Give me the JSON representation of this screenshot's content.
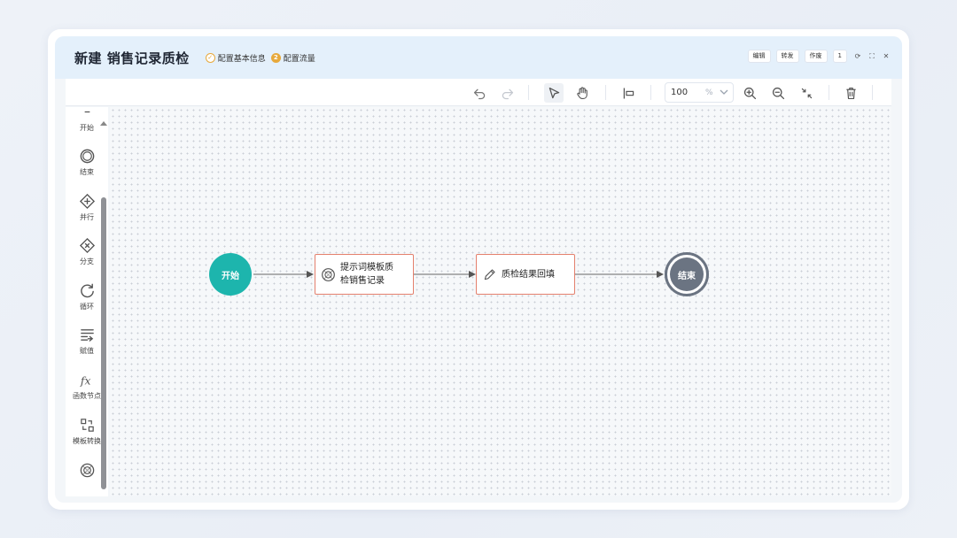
{
  "header": {
    "title": "新建 销售记录质检",
    "steps": [
      {
        "label": "配置基本信息",
        "state": "done"
      },
      {
        "label": "配置流量",
        "state": "current"
      }
    ],
    "actions": [
      {
        "label": "编辑"
      },
      {
        "label": "转发"
      },
      {
        "label": "作废"
      },
      {
        "label": "1"
      }
    ],
    "accent_color": "#e7a93c"
  },
  "toolbar": {
    "zoom_value": "100",
    "zoom_unit": "%",
    "tools": [
      "undo-icon",
      "redo-icon",
      "select-pointer-icon",
      "hand-pan-icon",
      "align-icon",
      "zoom-in-icon",
      "zoom-out-icon",
      "fit-view-icon",
      "delete-icon"
    ]
  },
  "sidebar": {
    "items": [
      {
        "label": "开始",
        "icon": "start-icon"
      },
      {
        "label": "结束",
        "icon": "end-circle-icon"
      },
      {
        "label": "并行",
        "icon": "parallel-gateway-icon"
      },
      {
        "label": "分支",
        "icon": "branch-gateway-icon"
      },
      {
        "label": "循环",
        "icon": "loop-icon"
      },
      {
        "label": "赋值",
        "icon": "assign-icon"
      },
      {
        "label": "函数节点",
        "icon": "function-icon"
      },
      {
        "label": "模板转换",
        "icon": "template-convert-icon"
      },
      {
        "label": "",
        "icon": "llm-model-icon"
      }
    ]
  },
  "flow": {
    "nodes": [
      {
        "id": "start",
        "label": "开始",
        "color": "#1db5ad"
      },
      {
        "id": "prompt",
        "label_line1": "提示词模板质",
        "label_line2": "检销售记录",
        "icon": "llm-model-icon",
        "border": "#e4806d"
      },
      {
        "id": "fill",
        "label": "质检结果回填",
        "icon": "pencil-icon",
        "border": "#e4806d"
      },
      {
        "id": "end",
        "label": "结束",
        "color": "#6b7482"
      }
    ],
    "edges": [
      {
        "from": "start",
        "to": "prompt"
      },
      {
        "from": "prompt",
        "to": "fill"
      },
      {
        "from": "fill",
        "to": "end"
      }
    ]
  }
}
